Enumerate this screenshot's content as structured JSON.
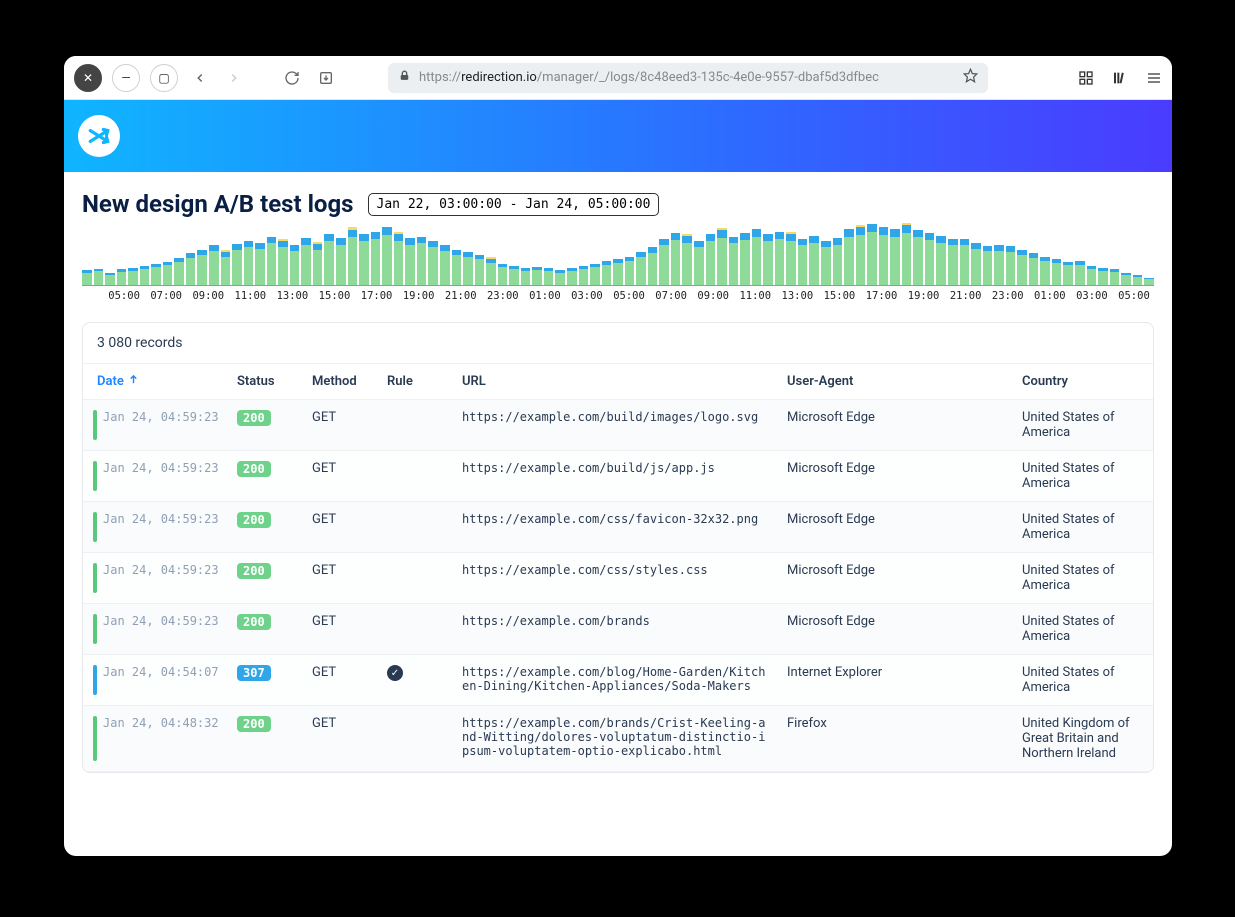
{
  "browser": {
    "url_prefix": "https://",
    "url_domain": "redirection.io",
    "url_path": "/manager/_/logs/8c48eed3-135c-4e0e-9557-dbaf5d3dfbec"
  },
  "app": {
    "title": "New design A/B test logs",
    "range": "Jan 22, 03:00:00 - Jan 24, 05:00:00",
    "records_label": "3 080 records"
  },
  "columns": {
    "date": "Date",
    "status": "Status",
    "method": "Method",
    "rule": "Rule",
    "url": "URL",
    "ua": "User-Agent",
    "country": "Country"
  },
  "chart_data": {
    "type": "bar",
    "xlabel": "",
    "ylabel": "",
    "start": "Jan 22 03:00",
    "end": "Jan 24 05:00",
    "x_ticks": [
      "05:00",
      "07:00",
      "09:00",
      "11:00",
      "13:00",
      "15:00",
      "17:00",
      "19:00",
      "21:00",
      "23:00",
      "01:00",
      "03:00",
      "05:00",
      "07:00",
      "09:00",
      "11:00",
      "13:00",
      "15:00",
      "17:00",
      "19:00",
      "21:00",
      "23:00",
      "01:00",
      "03:00",
      "05:00"
    ],
    "series_order": [
      "ok",
      "redirect",
      "other"
    ],
    "colors": {
      "ok": "#8eda99",
      "redirect": "#2fa6e8",
      "other": "#f7d964"
    },
    "note": "stacked hourly counts; values are relative pixel heights out of 60 read from the plot",
    "bars": [
      {
        "g": 12,
        "b": 3,
        "y": 0
      },
      {
        "g": 14,
        "b": 2,
        "y": 0
      },
      {
        "g": 10,
        "b": 2,
        "y": 0
      },
      {
        "g": 13,
        "b": 3,
        "y": 0
      },
      {
        "g": 14,
        "b": 3,
        "y": 0
      },
      {
        "g": 16,
        "b": 3,
        "y": 0
      },
      {
        "g": 18,
        "b": 3,
        "y": 0
      },
      {
        "g": 20,
        "b": 3,
        "y": 0
      },
      {
        "g": 23,
        "b": 4,
        "y": 0
      },
      {
        "g": 27,
        "b": 5,
        "y": 0
      },
      {
        "g": 30,
        "b": 5,
        "y": 0
      },
      {
        "g": 34,
        "b": 6,
        "y": 0
      },
      {
        "g": 28,
        "b": 5,
        "y": 2
      },
      {
        "g": 35,
        "b": 6,
        "y": 0
      },
      {
        "g": 38,
        "b": 6,
        "y": 0
      },
      {
        "g": 36,
        "b": 6,
        "y": 0
      },
      {
        "g": 42,
        "b": 6,
        "y": 0
      },
      {
        "g": 38,
        "b": 6,
        "y": 2
      },
      {
        "g": 34,
        "b": 6,
        "y": 0
      },
      {
        "g": 40,
        "b": 7,
        "y": 0
      },
      {
        "g": 35,
        "b": 6,
        "y": 2
      },
      {
        "g": 44,
        "b": 7,
        "y": 0
      },
      {
        "g": 40,
        "b": 7,
        "y": 0
      },
      {
        "g": 48,
        "b": 7,
        "y": 3
      },
      {
        "g": 44,
        "b": 7,
        "y": 0
      },
      {
        "g": 46,
        "b": 7,
        "y": 0
      },
      {
        "g": 50,
        "b": 8,
        "y": 0
      },
      {
        "g": 44,
        "b": 7,
        "y": 2
      },
      {
        "g": 40,
        "b": 7,
        "y": 0
      },
      {
        "g": 42,
        "b": 6,
        "y": 0
      },
      {
        "g": 38,
        "b": 6,
        "y": 0
      },
      {
        "g": 34,
        "b": 6,
        "y": 0
      },
      {
        "g": 30,
        "b": 5,
        "y": 0
      },
      {
        "g": 28,
        "b": 5,
        "y": 0
      },
      {
        "g": 26,
        "b": 4,
        "y": 0
      },
      {
        "g": 22,
        "b": 4,
        "y": 2
      },
      {
        "g": 18,
        "b": 3,
        "y": 0
      },
      {
        "g": 16,
        "b": 3,
        "y": 0
      },
      {
        "g": 14,
        "b": 3,
        "y": 0
      },
      {
        "g": 15,
        "b": 3,
        "y": 0
      },
      {
        "g": 14,
        "b": 3,
        "y": 0
      },
      {
        "g": 12,
        "b": 3,
        "y": 0
      },
      {
        "g": 14,
        "b": 3,
        "y": 0
      },
      {
        "g": 16,
        "b": 3,
        "y": 0
      },
      {
        "g": 18,
        "b": 3,
        "y": 0
      },
      {
        "g": 20,
        "b": 4,
        "y": 0
      },
      {
        "g": 22,
        "b": 4,
        "y": 0
      },
      {
        "g": 24,
        "b": 4,
        "y": 0
      },
      {
        "g": 28,
        "b": 5,
        "y": 0
      },
      {
        "g": 32,
        "b": 6,
        "y": 0
      },
      {
        "g": 40,
        "b": 6,
        "y": 0
      },
      {
        "g": 45,
        "b": 7,
        "y": 0
      },
      {
        "g": 42,
        "b": 7,
        "y": 2
      },
      {
        "g": 38,
        "b": 6,
        "y": 0
      },
      {
        "g": 44,
        "b": 7,
        "y": 0
      },
      {
        "g": 47,
        "b": 8,
        "y": 2
      },
      {
        "g": 42,
        "b": 6,
        "y": 0
      },
      {
        "g": 45,
        "b": 7,
        "y": 0
      },
      {
        "g": 48,
        "b": 8,
        "y": 0
      },
      {
        "g": 44,
        "b": 7,
        "y": 0
      },
      {
        "g": 46,
        "b": 7,
        "y": 0
      },
      {
        "g": 44,
        "b": 7,
        "y": 2
      },
      {
        "g": 40,
        "b": 6,
        "y": 0
      },
      {
        "g": 42,
        "b": 7,
        "y": 0
      },
      {
        "g": 38,
        "b": 6,
        "y": 0
      },
      {
        "g": 40,
        "b": 7,
        "y": 0
      },
      {
        "g": 48,
        "b": 8,
        "y": 0
      },
      {
        "g": 50,
        "b": 8,
        "y": 2
      },
      {
        "g": 53,
        "b": 8,
        "y": 0
      },
      {
        "g": 50,
        "b": 8,
        "y": 0
      },
      {
        "g": 48,
        "b": 8,
        "y": 0
      },
      {
        "g": 52,
        "b": 8,
        "y": 2
      },
      {
        "g": 48,
        "b": 7,
        "y": 0
      },
      {
        "g": 45,
        "b": 7,
        "y": 0
      },
      {
        "g": 42,
        "b": 7,
        "y": 0
      },
      {
        "g": 40,
        "b": 6,
        "y": 0
      },
      {
        "g": 40,
        "b": 6,
        "y": 0
      },
      {
        "g": 36,
        "b": 6,
        "y": 0
      },
      {
        "g": 34,
        "b": 5,
        "y": 0
      },
      {
        "g": 34,
        "b": 6,
        "y": 0
      },
      {
        "g": 33,
        "b": 6,
        "y": 0
      },
      {
        "g": 30,
        "b": 5,
        "y": 0
      },
      {
        "g": 27,
        "b": 5,
        "y": 0
      },
      {
        "g": 24,
        "b": 4,
        "y": 0
      },
      {
        "g": 22,
        "b": 4,
        "y": 0
      },
      {
        "g": 20,
        "b": 3,
        "y": 0
      },
      {
        "g": 20,
        "b": 4,
        "y": 0
      },
      {
        "g": 16,
        "b": 3,
        "y": 0
      },
      {
        "g": 14,
        "b": 3,
        "y": 0
      },
      {
        "g": 13,
        "b": 3,
        "y": 0
      },
      {
        "g": 10,
        "b": 2,
        "y": 0
      },
      {
        "g": 8,
        "b": 2,
        "y": 0
      },
      {
        "g": 6,
        "b": 1,
        "y": 0
      }
    ]
  },
  "rows": [
    {
      "date": "Jan 24, 04:59:23",
      "status": "200",
      "status_kind": "ok",
      "method": "GET",
      "rule": false,
      "url": "https://example.com/build/images/logo.svg",
      "ua": "Microsoft Edge",
      "country": "United States of America"
    },
    {
      "date": "Jan 24, 04:59:23",
      "status": "200",
      "status_kind": "ok",
      "method": "GET",
      "rule": false,
      "url": "https://example.com/build/js/app.js",
      "ua": "Microsoft Edge",
      "country": "United States of America"
    },
    {
      "date": "Jan 24, 04:59:23",
      "status": "200",
      "status_kind": "ok",
      "method": "GET",
      "rule": false,
      "url": "https://example.com/css/favicon-32x32.png",
      "ua": "Microsoft Edge",
      "country": "United States of America"
    },
    {
      "date": "Jan 24, 04:59:23",
      "status": "200",
      "status_kind": "ok",
      "method": "GET",
      "rule": false,
      "url": "https://example.com/css/styles.css",
      "ua": "Microsoft Edge",
      "country": "United States of America"
    },
    {
      "date": "Jan 24, 04:59:23",
      "status": "200",
      "status_kind": "ok",
      "method": "GET",
      "rule": false,
      "url": "https://example.com/brands",
      "ua": "Microsoft Edge",
      "country": "United States of America"
    },
    {
      "date": "Jan 24, 04:54:07",
      "status": "307",
      "status_kind": "redir",
      "method": "GET",
      "rule": true,
      "url": "https://example.com/blog/Home-Garden/Kitchen-Dining/Kitchen-Appliances/Soda-Makers",
      "ua": "Internet Explorer",
      "country": "United States of America"
    },
    {
      "date": "Jan 24, 04:48:32",
      "status": "200",
      "status_kind": "ok",
      "method": "GET",
      "rule": false,
      "url": "https://example.com/brands/Crist-Keeling-and-Witting/dolores-voluptatum-distinctio-ipsum-voluptatem-optio-explicabo.html",
      "ua": "Firefox",
      "country": "United Kingdom of Great Britain and Northern Ireland"
    }
  ]
}
